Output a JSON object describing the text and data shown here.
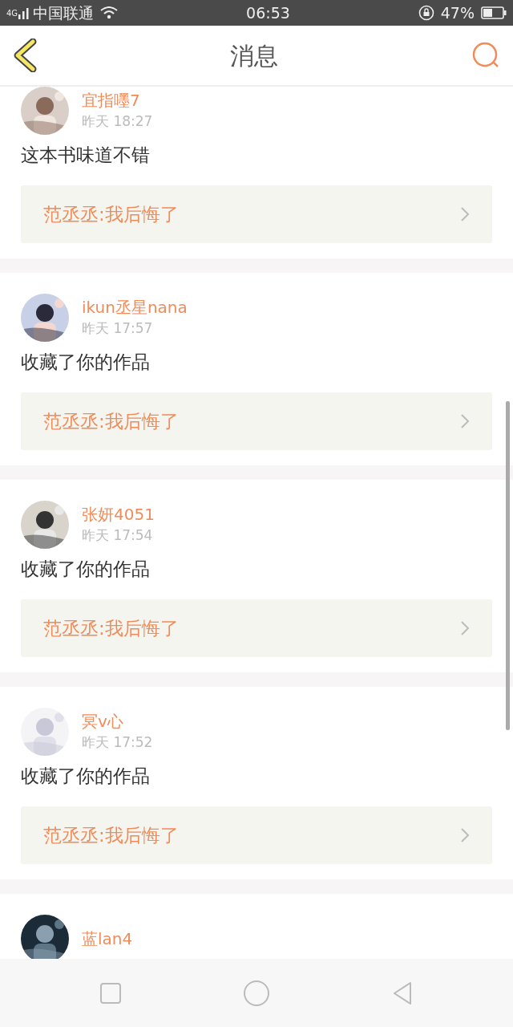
{
  "status_bar": {
    "network": "4G",
    "carrier": "中国联通",
    "time": "06:53",
    "battery": "47%"
  },
  "header": {
    "title": "消息"
  },
  "messages": [
    {
      "user": "宜指嚜7",
      "time": "昨天 18:27",
      "text": "这本书味道不错",
      "quote": "范丞丞:我后悔了"
    },
    {
      "user": "ikun丞星nana",
      "time": "昨天 17:57",
      "text": "收藏了你的作品",
      "quote": "范丞丞:我后悔了"
    },
    {
      "user": "张妍4051",
      "time": "昨天 17:54",
      "text": "收藏了你的作品",
      "quote": "范丞丞:我后悔了"
    },
    {
      "user": "冥v心",
      "time": "昨天 17:52",
      "text": "收藏了你的作品",
      "quote": "范丞丞:我后悔了"
    },
    {
      "user": "蓝lan4"
    }
  ]
}
